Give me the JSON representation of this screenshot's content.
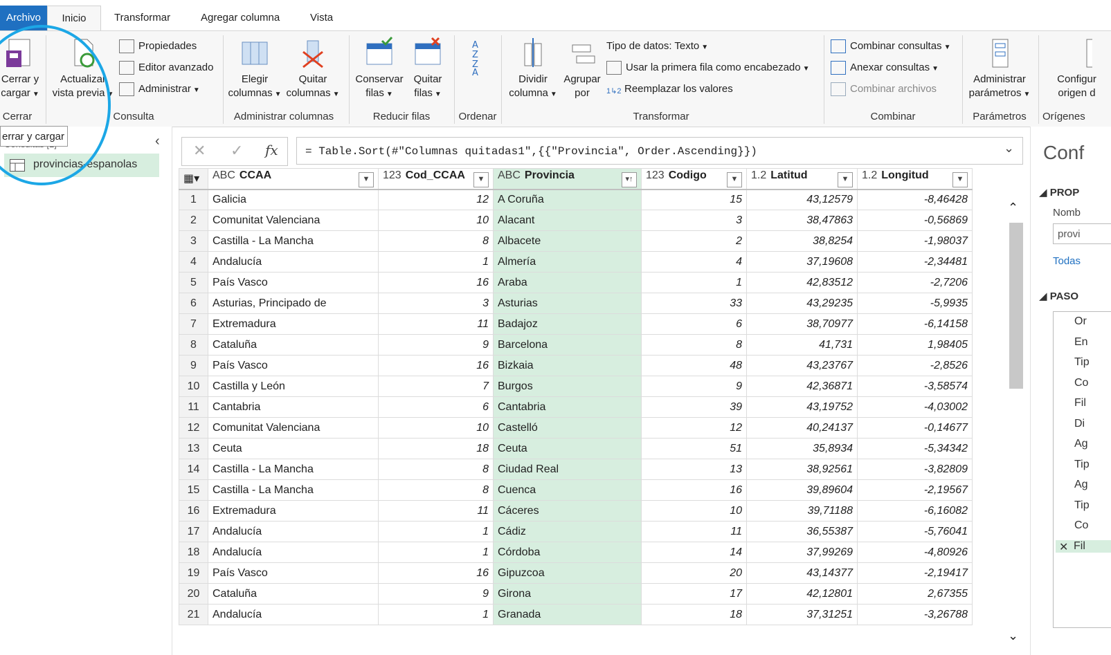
{
  "tabs": {
    "file": "Archivo",
    "home": "Inicio",
    "transform": "Transformar",
    "add_column": "Agregar columna",
    "view": "Vista"
  },
  "ribbon": {
    "close_load": "Cerrar y",
    "close_load2": "cargar",
    "refresh": "Actualizar",
    "refresh2": "vista previa",
    "properties": "Propiedades",
    "advanced_editor": "Editor avanzado",
    "manage": "Administrar",
    "choose_cols": "Elegir",
    "choose_cols2": "columnas",
    "remove_cols": "Quitar",
    "remove_cols2": "columnas",
    "keep_rows": "Conservar",
    "keep_rows2": "filas",
    "remove_rows": "Quitar",
    "remove_rows2": "filas",
    "split": "Dividir",
    "split2": "columna",
    "group": "Agrupar",
    "group2": "por",
    "datatype": "Tipo de datos: Texto",
    "first_row": "Usar la primera fila como encabezado",
    "replace": "Reemplazar los valores",
    "merge": "Combinar consultas",
    "append": "Anexar consultas",
    "combine_files": "Combinar archivos",
    "params": "Administrar",
    "params2": "parámetros",
    "datasrc": "Configur",
    "datasrc2": "origen d",
    "groups": {
      "close": "Cerrar",
      "query": "Consulta",
      "manage_cols": "Administrar columnas",
      "reduce": "Reducir filas",
      "sort": "Ordenar",
      "transform": "Transformar",
      "combine": "Combinar",
      "params": "Parámetros",
      "sources": "Orígenes"
    }
  },
  "tooltip": "errar y cargar",
  "left": {
    "queries_header": "Consultas [1]",
    "query": "provincias-espanolas"
  },
  "formula": "= Table.Sort(#\"Columnas quitadas1\",{{\"Provincia\", Order.Ascending}})",
  "columns": [
    {
      "type": "ABC",
      "name": "CCAA"
    },
    {
      "type": "123",
      "name": "Cod_CCAA"
    },
    {
      "type": "ABC",
      "name": "Provincia"
    },
    {
      "type": "123",
      "name": "Codigo"
    },
    {
      "type": "1.2",
      "name": "Latitud"
    },
    {
      "type": "1.2",
      "name": "Longitud"
    }
  ],
  "rows": [
    [
      "Galicia",
      "12",
      "A Coruña",
      "15",
      "43,12579",
      "-8,46428"
    ],
    [
      "Comunitat Valenciana",
      "10",
      "Alacant",
      "3",
      "38,47863",
      "-0,56869"
    ],
    [
      "Castilla - La Mancha",
      "8",
      "Albacete",
      "2",
      "38,8254",
      "-1,98037"
    ],
    [
      "Andalucía",
      "1",
      "Almería",
      "4",
      "37,19608",
      "-2,34481"
    ],
    [
      "País Vasco",
      "16",
      "Araba",
      "1",
      "42,83512",
      "-2,7206"
    ],
    [
      "Asturias, Principado de",
      "3",
      "Asturias",
      "33",
      "43,29235",
      "-5,9935"
    ],
    [
      "Extremadura",
      "11",
      "Badajoz",
      "6",
      "38,70977",
      "-6,14158"
    ],
    [
      "Cataluña",
      "9",
      "Barcelona",
      "8",
      "41,731",
      "1,98405"
    ],
    [
      "País Vasco",
      "16",
      "Bizkaia",
      "48",
      "43,23767",
      "-2,8526"
    ],
    [
      "Castilla y León",
      "7",
      "Burgos",
      "9",
      "42,36871",
      "-3,58574"
    ],
    [
      "Cantabria",
      "6",
      "Cantabria",
      "39",
      "43,19752",
      "-4,03002"
    ],
    [
      "Comunitat Valenciana",
      "10",
      "Castelló",
      "12",
      "40,24137",
      "-0,14677"
    ],
    [
      "Ceuta",
      "18",
      "Ceuta",
      "51",
      "35,8934",
      "-5,34342"
    ],
    [
      "Castilla - La Mancha",
      "8",
      "Ciudad Real",
      "13",
      "38,92561",
      "-3,82809"
    ],
    [
      "Castilla - La Mancha",
      "8",
      "Cuenca",
      "16",
      "39,89604",
      "-2,19567"
    ],
    [
      "Extremadura",
      "11",
      "Cáceres",
      "10",
      "39,71188",
      "-6,16082"
    ],
    [
      "Andalucía",
      "1",
      "Cádiz",
      "11",
      "36,55387",
      "-5,76041"
    ],
    [
      "Andalucía",
      "1",
      "Córdoba",
      "14",
      "37,99269",
      "-4,80926"
    ],
    [
      "País Vasco",
      "16",
      "Gipuzcoa",
      "20",
      "43,14377",
      "-2,19417"
    ],
    [
      "Cataluña",
      "9",
      "Girona",
      "17",
      "42,12801",
      "2,67355"
    ],
    [
      "Andalucía",
      "1",
      "Granada",
      "18",
      "37,31251",
      "-3,26788"
    ]
  ],
  "right": {
    "title": "Conf",
    "props": "PROP",
    "name_label": "Nomb",
    "name_value": "provi",
    "all_props": "Todas",
    "steps_header": "PASO",
    "steps": [
      "Or",
      "En",
      "Tip",
      "Co",
      "Fil",
      "Di",
      "Ag",
      "Tip",
      "Ag",
      "Tip",
      "Co",
      "Fil"
    ]
  }
}
